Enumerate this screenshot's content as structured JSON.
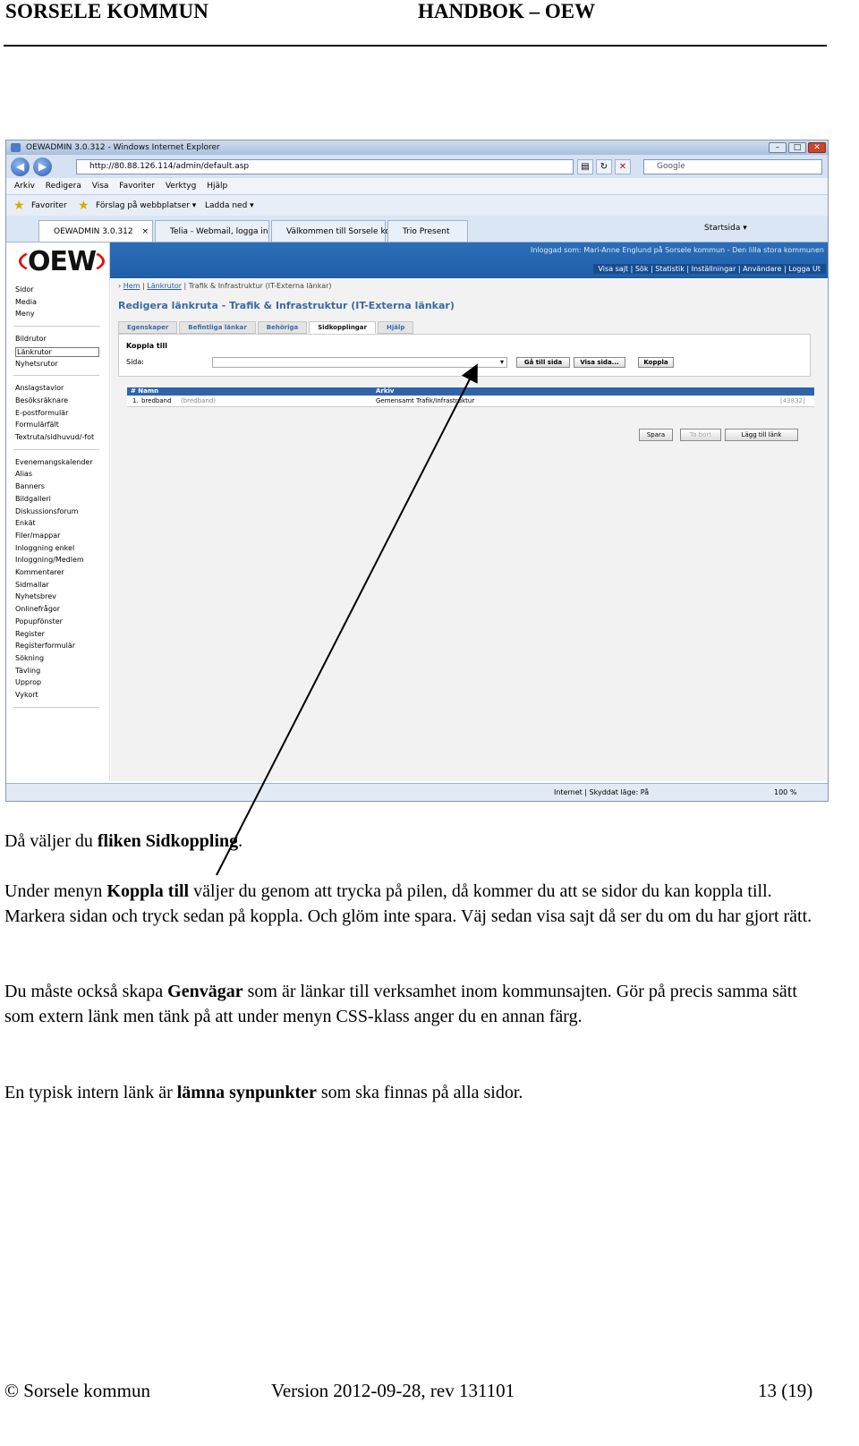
{
  "header": {
    "left": "SORSELE KOMMUN",
    "right": "HANDBOK – OEW"
  },
  "browser": {
    "title": "OEWADMIN 3.0.312 - Windows Internet Explorer",
    "url": "http://80.88.126.114/admin/default.asp",
    "search_placeholder": "Google",
    "menu": [
      "Arkiv",
      "Redigera",
      "Visa",
      "Favoriter",
      "Verktyg",
      "Hjälp"
    ],
    "favorites": {
      "favoriter": "Favoriter",
      "forslag": "Förslag på webbplatser ▾",
      "ladda": "Ladda ned ▾"
    },
    "tabs": [
      "OEWADMIN 3.0.312",
      "Telia - Webmail, logga in",
      "Välkommen till Sorsele ko...",
      "Trio Present"
    ],
    "startsida": "Startsida ▾",
    "status_zone": "Internet | Skyddat läge: På",
    "zoom": "100 %"
  },
  "app": {
    "logo": "OEW",
    "login_info": "Inloggad som: Mari-Anne Englund på Sorsele kommun - Den lilla stora kommunen",
    "topnav": "Visa sajt | Sök | Statistik | Inställningar | Användare | Logga Ut",
    "sidebar_groups": [
      [
        "Sidor",
        "Media",
        "Meny"
      ],
      [
        "Bildrutor",
        "Länkrutor",
        "Nyhetsrutor"
      ],
      [
        "Anslagstavlor",
        "Besöksräknare",
        "E-postformulär",
        "Formulärfält",
        "Textruta/sidhuvud/-fot"
      ],
      [
        "Evenemangskalender",
        "Alias",
        "Banners",
        "Bildgalleri",
        "Diskussionsforum",
        "Enkät",
        "Filer/mappar",
        "Inloggning enkel",
        "Inloggning/Medlem",
        "Kommentarer",
        "Sidmallar",
        "Nyhetsbrev",
        "Onlinefrågor",
        "Popupfönster",
        "Register",
        "Registerformulär",
        "Sökning",
        "Tävling",
        "Upprop",
        "Vykort"
      ]
    ],
    "breadcrumb": {
      "hem": "Hem",
      "lankrutor": "Länkrutor",
      "rest": "Trafik & Infrastruktur (IT-Externa länkar)"
    },
    "page_title": "Redigera länkruta - Trafik & Infrastruktur (IT-Externa länkar)",
    "tabs": [
      "Egenskaper",
      "Befintliga länkar",
      "Behöriga",
      "Sidkopplingar",
      "Hjälp"
    ],
    "koppla": {
      "heading": "Koppla till",
      "sida_label": "Sida:",
      "btn_ga": "Gå till sida",
      "btn_visa": "Visa sida...",
      "btn_koppla": "Koppla"
    },
    "table": {
      "headers": [
        "# Namn",
        "Arkiv"
      ],
      "row": {
        "num": "1.",
        "name": "bredband",
        "alias": "(bredband)",
        "arkiv": "Gemensamt Trafik/Infrastruktur",
        "id": "[43832]"
      }
    },
    "actions": {
      "spara": "Spara",
      "ta_bort": "Ta bort",
      "lagg_till": "Lägg till länk"
    }
  },
  "text": {
    "p1_a": "Då väljer du ",
    "p1_b": "fliken Sidkoppling",
    "p1_c": ".",
    "p2_a": "Under menyn ",
    "p2_b": "Koppla till",
    "p2_c": " väljer du genom att trycka på pilen, då kommer du att se sidor du kan koppla till. Markera sidan och tryck sedan på koppla. Och glöm inte spara. Väj sedan visa sajt då ser du om du har gjort rätt.",
    "p3_a": "Du måste också skapa ",
    "p3_b": "Genvägar",
    "p3_c": " som är länkar till verksamhet inom kommunsajten. Gör på precis samma sätt som extern länk men tänk på att under menyn CSS-klass anger du en annan färg.",
    "p4_a": "En typisk intern länk är ",
    "p4_b": "lämna synpunkter",
    "p4_c": " som ska finnas på alla sidor."
  },
  "footer": {
    "left": "© Sorsele kommun",
    "middle": "Version 2012-09-28, rev 131101",
    "right": "13  (19)"
  }
}
